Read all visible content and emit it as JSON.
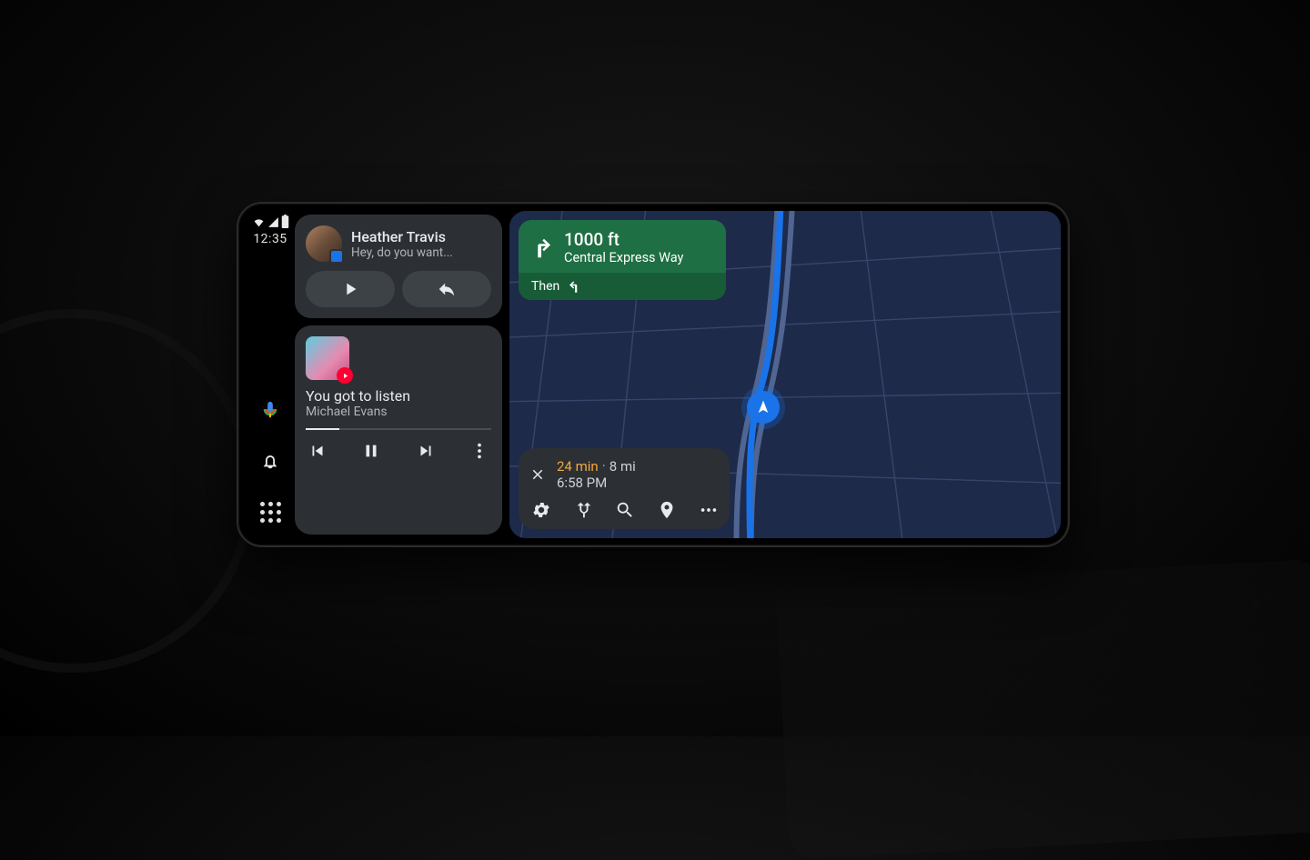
{
  "status": {
    "time": "12:35"
  },
  "notification": {
    "sender": "Heather Travis",
    "preview": "Hey, do you want..."
  },
  "media": {
    "track": "You got to listen",
    "artist": "Michael Evans"
  },
  "nav": {
    "distance": "1000 ft",
    "road": "Central Express Way",
    "then_label": "Then"
  },
  "eta": {
    "duration": "24 min",
    "distance": "8 mi",
    "arrival": "6:58 PM"
  }
}
